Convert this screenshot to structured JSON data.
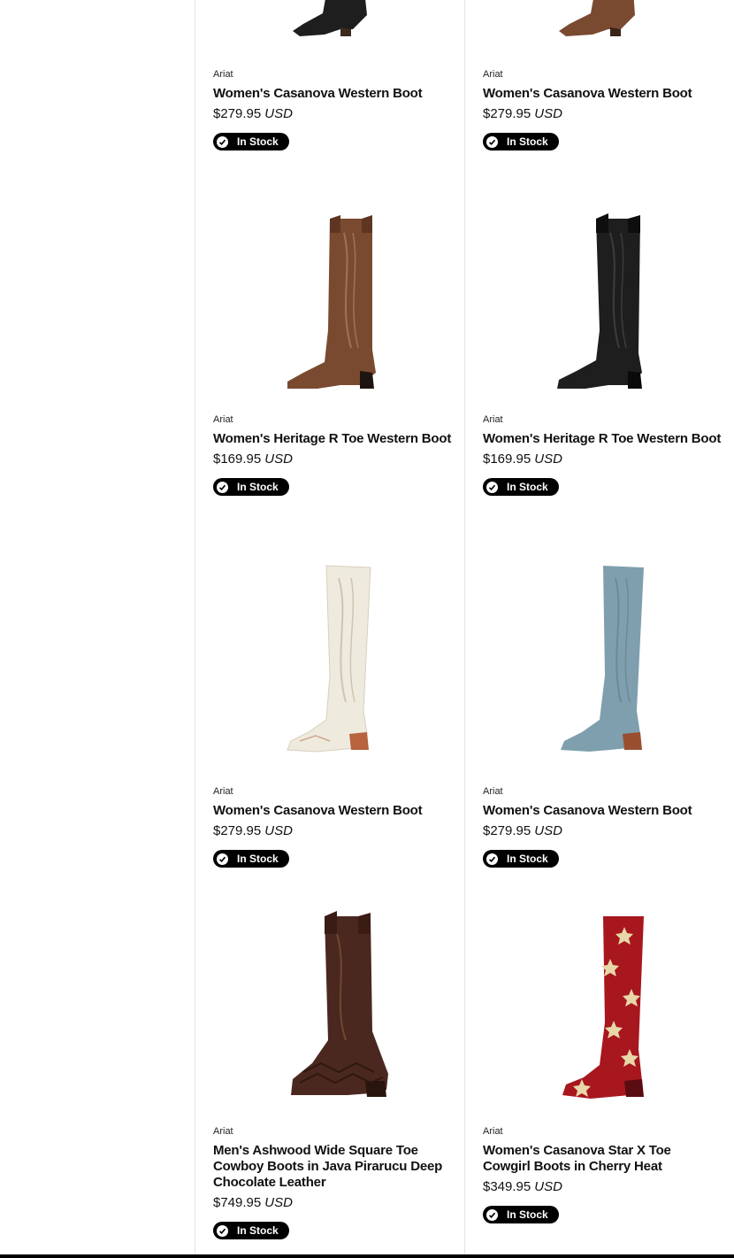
{
  "products": [
    {
      "brand": "Ariat",
      "name": "Women's Casanova Western Boot",
      "price": "$279.95",
      "currency": "USD",
      "stock": "In Stock",
      "image": "black-casanova-boot"
    },
    {
      "brand": "Ariat",
      "name": "Women's Casanova Western Boot",
      "price": "$279.95",
      "currency": "USD",
      "stock": "In Stock",
      "image": "brown-casanova-boot"
    },
    {
      "brand": "Ariat",
      "name": "Women's Heritage R Toe Western Boot",
      "price": "$169.95",
      "currency": "USD",
      "stock": "In Stock",
      "image": "brown-heritage-boot"
    },
    {
      "brand": "Ariat",
      "name": "Women's Heritage R Toe Western Boot",
      "price": "$169.95",
      "currency": "USD",
      "stock": "In Stock",
      "image": "black-heritage-boot"
    },
    {
      "brand": "Ariat",
      "name": "Women's Casanova Western Boot",
      "price": "$279.95",
      "currency": "USD",
      "stock": "In Stock",
      "image": "white-casanova-boot"
    },
    {
      "brand": "Ariat",
      "name": "Women's Casanova Western Boot",
      "price": "$279.95",
      "currency": "USD",
      "stock": "In Stock",
      "image": "blue-casanova-boot"
    },
    {
      "brand": "Ariat",
      "name": "Men's Ashwood Wide Square Toe Cowboy Boots in Java Pirarucu Deep Chocolate Leather",
      "price": "$749.95",
      "currency": "USD",
      "stock": "In Stock",
      "image": "chocolate-pirarucu-boot"
    },
    {
      "brand": "Ariat",
      "name": "Women's Casanova Star X Toe Cowgirl Boots in Cherry Heat",
      "price": "$349.95",
      "currency": "USD",
      "stock": "In Stock",
      "image": "red-star-boot"
    }
  ],
  "colors": {
    "badge_bg": "#000000",
    "badge_text": "#ffffff",
    "divider": "#e3e3e3",
    "boot_black": "#1e1e1e",
    "boot_brown": "#7a4a30",
    "boot_white": "#efeade",
    "boot_blue": "#7f9fae",
    "boot_chocolate": "#4a2820",
    "boot_red": "#a8161e"
  }
}
